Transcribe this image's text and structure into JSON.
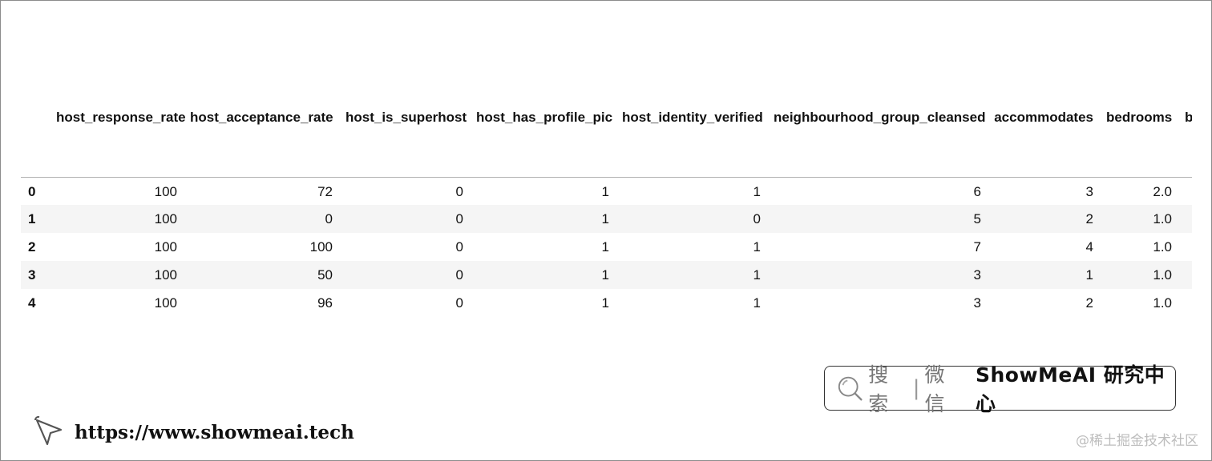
{
  "table": {
    "columns": [
      "",
      "host_response_rate",
      "host_acceptance_rate",
      "host_is_superhost",
      "host_has_profile_pic",
      "host_identity_verified",
      "neighbourhood_group_cleansed",
      "accommodates",
      "bedrooms",
      "b"
    ],
    "rows": [
      [
        "0",
        "100",
        "72",
        "0",
        "1",
        "1",
        "6",
        "3",
        "2.0",
        ""
      ],
      [
        "1",
        "100",
        "0",
        "0",
        "1",
        "0",
        "5",
        "2",
        "1.0",
        ""
      ],
      [
        "2",
        "100",
        "100",
        "0",
        "1",
        "1",
        "7",
        "4",
        "1.0",
        ""
      ],
      [
        "3",
        "100",
        "50",
        "0",
        "1",
        "1",
        "3",
        "1",
        "1.0",
        ""
      ],
      [
        "4",
        "100",
        "96",
        "0",
        "1",
        "1",
        "3",
        "2",
        "1.0",
        ""
      ]
    ]
  },
  "brand": {
    "search_icon": "search-icon",
    "search_text": "搜索",
    "separator": "|",
    "wechat_text": "微信",
    "name": "ShowMeAI 研究中心"
  },
  "site": {
    "icon": "cursor-icon",
    "url": "https://www.showmeai.tech"
  },
  "watermark": "@稀土掘金技术社区"
}
